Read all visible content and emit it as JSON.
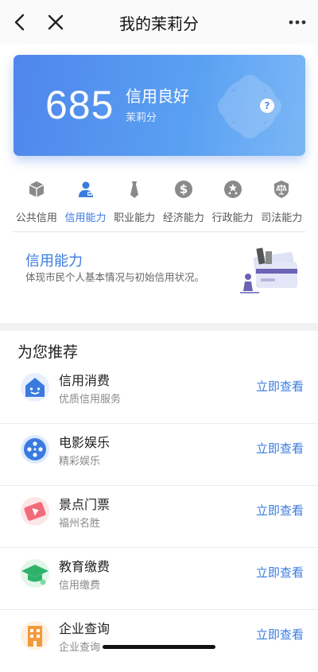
{
  "nav": {
    "title": "我的茉莉分",
    "back_icon": "chevron-left-icon",
    "close_icon": "close-icon",
    "more_icon": "more-dots-icon"
  },
  "score_card": {
    "score": "685",
    "level": "信用良好",
    "brand": "茉莉分",
    "help": "?",
    "gradient_start": "#4f86ec",
    "gradient_end": "#7bb7f6"
  },
  "categories": [
    {
      "label": "公共信用",
      "icon": "cube-icon"
    },
    {
      "label": "信用能力",
      "icon": "person-badge-icon"
    },
    {
      "label": "职业能力",
      "icon": "tie-icon"
    },
    {
      "label": "经济能力",
      "icon": "dollar-icon"
    },
    {
      "label": "行政能力",
      "icon": "stars-icon"
    },
    {
      "label": "司法能力",
      "icon": "scales-icon"
    }
  ],
  "active_category": "信用能力",
  "ability": {
    "title": "信用能力",
    "desc": "体现市民个人基本情况与初始信用状况。"
  },
  "recommend": {
    "title": "为您推荐",
    "action_label": "立即查看",
    "items": [
      {
        "name": "信用消费",
        "sub": "优质信用服务",
        "icon": "house-smile-icon"
      },
      {
        "name": "电影娱乐",
        "sub": "精彩娱乐",
        "icon": "film-reel-icon"
      },
      {
        "name": "景点门票",
        "sub": "福州名胜",
        "icon": "ticket-icon"
      },
      {
        "name": "教育缴费",
        "sub": "信用缴费",
        "icon": "graduation-cap-icon"
      },
      {
        "name": "企业查询",
        "sub": "企业查询",
        "icon": "building-icon"
      }
    ]
  },
  "colors": {
    "accent": "#3a7be0",
    "muted_text": "#888888"
  }
}
